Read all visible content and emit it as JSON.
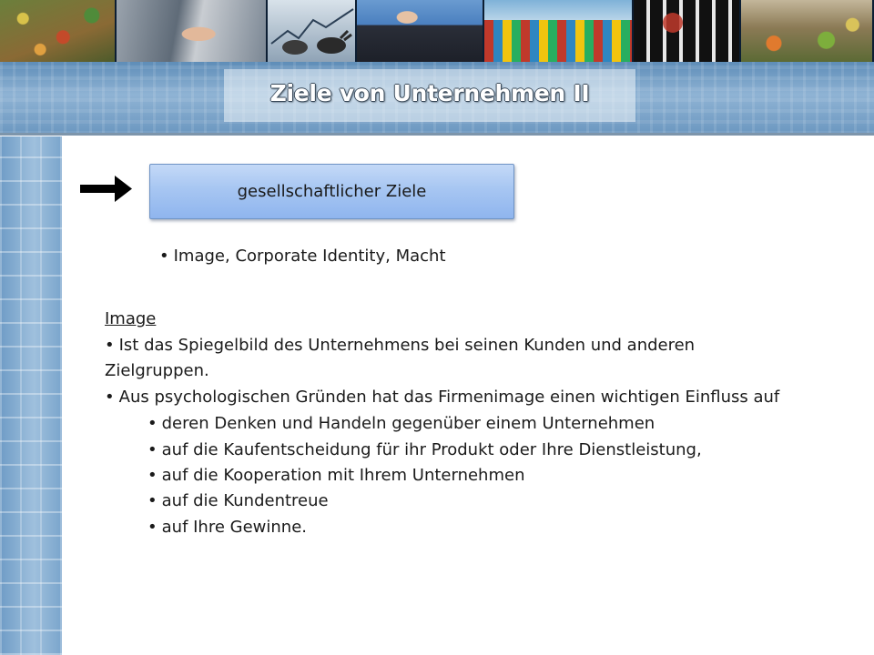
{
  "slide": {
    "title": "Ziele von Unternehmen II",
    "goal_box_label": "gesellschaftlicher Ziele",
    "summary_bullet": "Image, Corporate Identity, Macht",
    "section_heading": "Image",
    "bullet_glyph": "•",
    "points": [
      "Ist das Spiegelbild des Unternehmens bei seinen Kunden und anderen",
      "Zielgruppen.",
      "Aus psychologischen Gründen hat das Firmenimage einen wichtigen Einfluss auf"
    ],
    "sub_points": [
      "deren Denken und Handeln gegenüber einem Unternehmen",
      "auf die Kaufentscheidung für ihr Produkt oder Ihre Dienstleistung,",
      "auf die Kooperation mit Ihrem Unternehmen",
      "auf die Kundentreue",
      "auf Ihre Gewinne."
    ]
  },
  "header_photos": [
    "market-stalls-photo",
    "handshake-photo",
    "bull-and-bear-photo",
    "business-meeting-photo",
    "container-port-photo",
    "office-window-photo",
    "vegetable-market-photo"
  ],
  "icons": {
    "arrow": "right-arrow-icon"
  },
  "colors": {
    "header_band": "#8fb3d4",
    "goal_box_fill": "#a7c6f2",
    "goal_box_border": "#6f93c4",
    "title_text": "#ffffff",
    "body_text": "#1a1a1a"
  }
}
